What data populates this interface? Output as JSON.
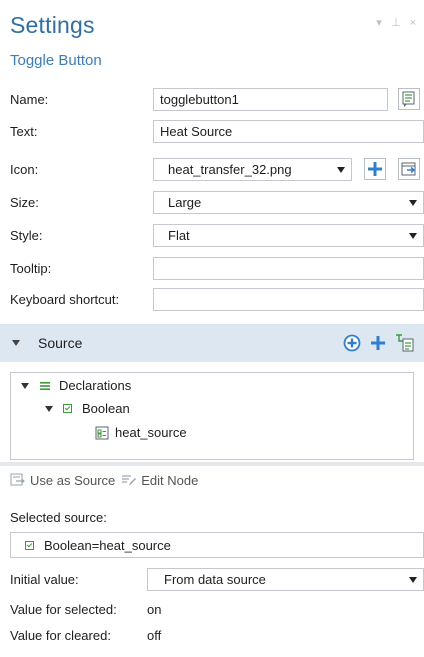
{
  "panel": {
    "title": "Settings",
    "subtitle": "Toggle Button",
    "window_buttons": [
      "▾",
      "⊥",
      "×"
    ]
  },
  "fields": {
    "name_label": "Name:",
    "name_value": "togglebutton1",
    "text_label": "Text:",
    "text_value": "Heat Source",
    "icon_label": "Icon:",
    "icon_value": "heat_transfer_32.png",
    "size_label": "Size:",
    "size_value": "Large",
    "style_label": "Style:",
    "style_value": "Flat",
    "tooltip_label": "Tooltip:",
    "tooltip_value": "",
    "shortcut_label": "Keyboard shortcut:",
    "shortcut_value": ""
  },
  "source_section": {
    "label": "Source",
    "tree": {
      "root": "Declarations",
      "child": "Boolean",
      "leaf": "heat_source"
    },
    "use_as_source_label": "Use as Source",
    "edit_node_label": "Edit Node",
    "selected_source_label": "Selected source:",
    "selected_source_value": "Boolean=heat_source"
  },
  "values": {
    "initial_value_label": "Initial value:",
    "initial_value": "From data source",
    "selected_label": "Value for selected:",
    "selected_value": "on",
    "cleared_label": "Value for cleared:",
    "cleared_value": "off"
  },
  "colors": {
    "title": "#2f6fa8",
    "section_bar": "#dde7f2",
    "accent_blue": "#2f7fd0",
    "boolean_green": "#3b9b3b"
  }
}
